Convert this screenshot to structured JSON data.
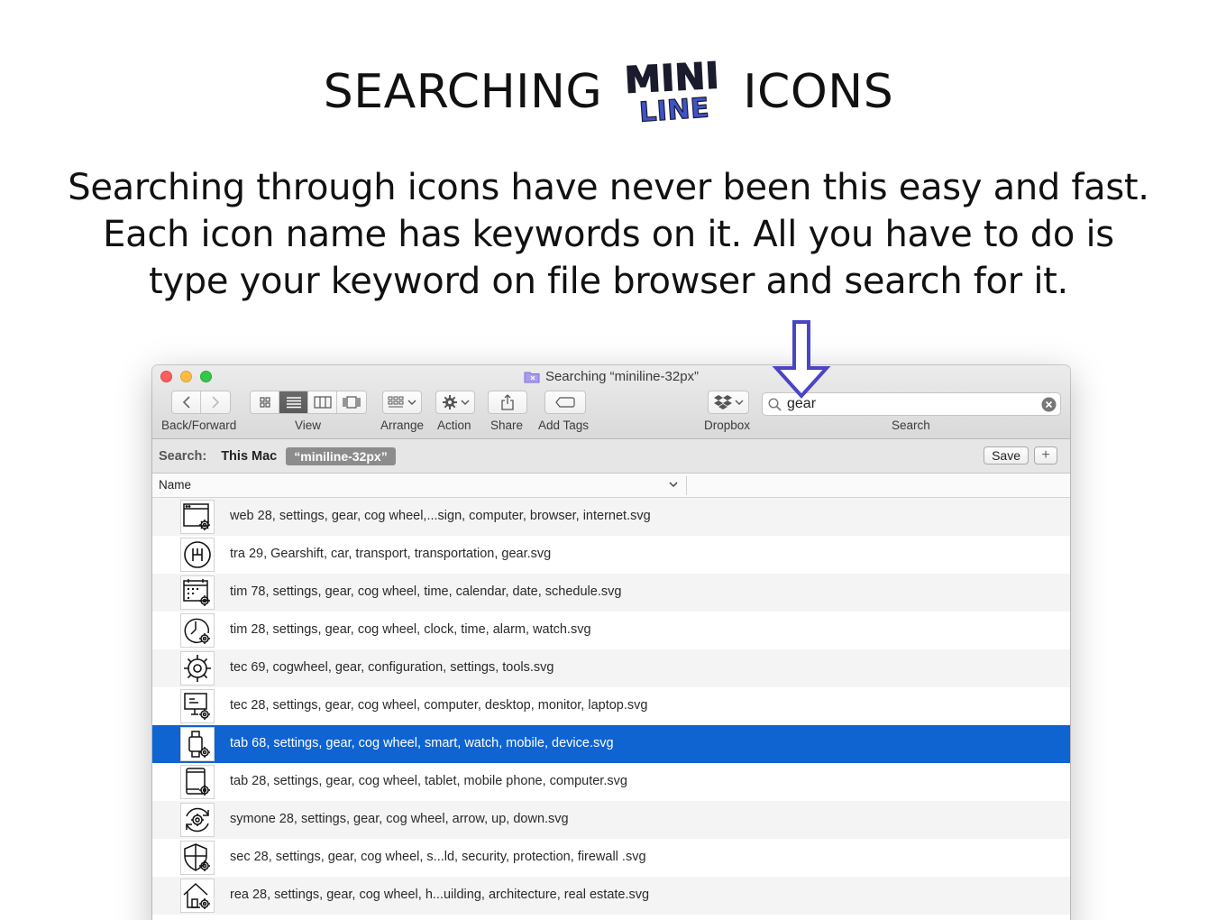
{
  "header": {
    "title_left": "SEARCHING",
    "logo_word_1": "MINI",
    "logo_word_2": "LINE",
    "title_right": "ICONS",
    "tagline_1": "Searching through icons have never been this easy and fast.",
    "tagline_2": "Each icon name has keywords on it.  All you have to do is",
    "tagline_3": "type your keyword on file browser and search for it."
  },
  "colors": {
    "accent_arrow": "#4a44c6",
    "selection": "#0f64d2",
    "logo_mini": "#1b1b2e",
    "logo_line": "#3f53c9"
  },
  "window": {
    "title": "Searching “miniline-32px”",
    "toolbar": {
      "back_forward_label": "Back/Forward",
      "view_label": "View",
      "arrange_label": "Arrange",
      "action_label": "Action",
      "share_label": "Share",
      "add_tags_label": "Add Tags",
      "dropbox_label": "Dropbox",
      "search_label": "Search",
      "search_value": "gear"
    },
    "scope": {
      "label": "Search:",
      "this_mac": "This Mac",
      "folder": "“miniline-32px”",
      "save": "Save",
      "plus": "+"
    },
    "columns": {
      "name": "Name"
    },
    "files": [
      {
        "name": "web 28, settings, gear, cog wheel,...sign, computer, browser, internet.svg",
        "icon": "browser-gear-icon"
      },
      {
        "name": "tra 29, Gearshift, car, transport, transportation, gear.svg",
        "icon": "gearshift-icon"
      },
      {
        "name": "tim 78, settings, gear, cog wheel, time, calendar, date, schedule.svg",
        "icon": "calendar-gear-icon"
      },
      {
        "name": "tim 28, settings, gear, cog wheel, clock, time, alarm, watch.svg",
        "icon": "clock-gear-icon"
      },
      {
        "name": "tec 69, cogwheel, gear, configuration, settings, tools.svg",
        "icon": "cogwheel-icon"
      },
      {
        "name": "tec 28, settings, gear, cog wheel, computer, desktop, monitor, laptop.svg",
        "icon": "monitor-gear-icon"
      },
      {
        "name": "tab 68, settings, gear, cog wheel, smart, watch, mobile, device.svg",
        "icon": "smartwatch-gear-icon",
        "selected": true
      },
      {
        "name": "tab 28, settings, gear, cog wheel, tablet, mobile phone, computer.svg",
        "icon": "tablet-gear-icon"
      },
      {
        "name": "symone 28, settings, gear, cog wheel, arrow, up, down.svg",
        "icon": "sync-gear-icon"
      },
      {
        "name": "sec 28, settings, gear, cog wheel, s...ld, security, protection, firewall .svg",
        "icon": "shield-gear-icon"
      },
      {
        "name": "rea 28, settings, gear, cog wheel, h...uilding, architecture, real estate.svg",
        "icon": "house-gear-icon"
      }
    ]
  }
}
